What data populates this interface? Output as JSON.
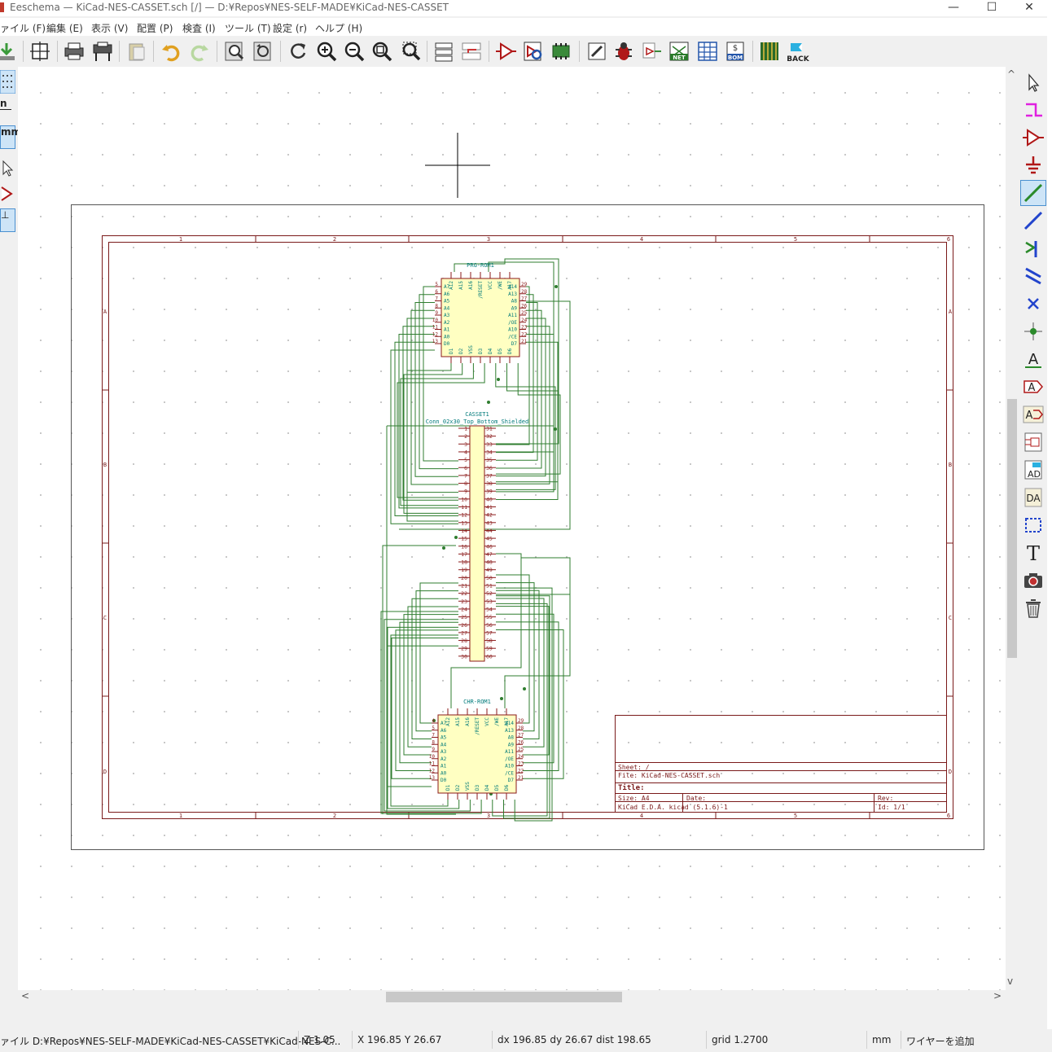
{
  "window": {
    "title": "Eeschema — KiCad-NES-CASSET.sch [/] — D:¥Repos¥NES-SELF-MADE¥KiCad-NES-CASSET",
    "controls": {
      "minimize": "—",
      "maximize": "☐",
      "close": "✕"
    }
  },
  "menu": [
    "ァイル (F)",
    "編集 (E)",
    "表示 (V)",
    "配置 (P)",
    "検査 (I)",
    "ツール (T)",
    "設定 (r)",
    "ヘルプ (H)"
  ],
  "toolbar": {
    "icons": [
      "save-icon",
      "page-settings-icon",
      "print-icon",
      "plot-icon",
      "paste-icon",
      "undo-icon",
      "redo-icon",
      "find-icon",
      "find-replace-icon",
      "redraw-icon",
      "zoom-in-icon",
      "zoom-out-icon",
      "zoom-fit-icon",
      "zoom-selection-icon",
      "hierarchy-navigator-icon",
      "leave-sheet-icon",
      "symbol-editor-icon",
      "symbol-browser-icon",
      "annotate-icon",
      "footprint-assign-icon",
      "erc-icon",
      "netlist-icon",
      "edit-fields-icon",
      "bom-icon",
      "pcbnew-icon",
      "back-annotate-icon"
    ],
    "net_label": "NET",
    "bom_label": "BOM",
    "back_label": "BACK"
  },
  "left_toolbar": {
    "labels": [
      "n",
      "mm",
      "⊥"
    ]
  },
  "schematic": {
    "frame_columns": [
      "1",
      "2",
      "3",
      "4",
      "5",
      "6"
    ],
    "frame_rows": [
      "A",
      "B",
      "C",
      "D"
    ],
    "prg_rom": {
      "ref": "PRG-ROM1",
      "left_pins": [
        {
          "num": "5",
          "name": "A7"
        },
        {
          "num": "6",
          "name": "A6"
        },
        {
          "num": "7",
          "name": "A5"
        },
        {
          "num": "8",
          "name": "A4"
        },
        {
          "num": "9",
          "name": "A3"
        },
        {
          "num": "10",
          "name": "A2"
        },
        {
          "num": "11",
          "name": "A1"
        },
        {
          "num": "12",
          "name": "A0"
        },
        {
          "num": "13",
          "name": "D0"
        }
      ],
      "right_pins": [
        {
          "num": "29",
          "name": "A14"
        },
        {
          "num": "28",
          "name": "A13"
        },
        {
          "num": "27",
          "name": "A8"
        },
        {
          "num": "26",
          "name": "A9"
        },
        {
          "num": "25",
          "name": "A11"
        },
        {
          "num": "24",
          "name": "/OE"
        },
        {
          "num": "23",
          "name": "A10"
        },
        {
          "num": "22",
          "name": "/CE"
        },
        {
          "num": "21",
          "name": "D7"
        }
      ],
      "top_pins": [
        "A12",
        "A15",
        "A16",
        "/RESET",
        "VCC",
        "/WE",
        "A17"
      ],
      "bottom_pins": [
        "D1",
        "D2",
        "VSS",
        "D3",
        "D4",
        "D5",
        "D6"
      ]
    },
    "connector": {
      "ref": "CASSET1",
      "value": "Conn_02x30_Top_Bottom_Shielded",
      "left_pins": [
        "1",
        "2",
        "3",
        "4",
        "5",
        "6",
        "7",
        "8",
        "9",
        "10",
        "11",
        "12",
        "13",
        "14",
        "15",
        "16",
        "17",
        "18",
        "19",
        "20",
        "21",
        "22",
        "23",
        "24",
        "25",
        "26",
        "27",
        "28",
        "29",
        "30"
      ],
      "right_pins": [
        "31",
        "32",
        "33",
        "34",
        "35",
        "36",
        "37",
        "38",
        "39",
        "40",
        "41",
        "42",
        "43",
        "44",
        "45",
        "46",
        "47",
        "48",
        "49",
        "50",
        "51",
        "52",
        "53",
        "54",
        "55",
        "56",
        "57",
        "58",
        "59",
        "60"
      ]
    },
    "chr_rom": {
      "ref": "CHR-ROM1",
      "left_pins": [
        {
          "num": "4",
          "name": "A7"
        },
        {
          "num": "5",
          "name": "A6"
        },
        {
          "num": "7",
          "name": "A5"
        },
        {
          "num": "8",
          "name": "A4"
        },
        {
          "num": "9",
          "name": "A3"
        },
        {
          "num": "10",
          "name": "A2"
        },
        {
          "num": "11",
          "name": "A1"
        },
        {
          "num": "12",
          "name": "A0"
        },
        {
          "num": "13",
          "name": "D0"
        }
      ],
      "right_pins": [
        {
          "num": "29",
          "name": "A14"
        },
        {
          "num": "28",
          "name": "A13"
        },
        {
          "num": "27",
          "name": "A8"
        },
        {
          "num": "26",
          "name": "A9"
        },
        {
          "num": "25",
          "name": "A11"
        },
        {
          "num": "24",
          "name": "/OE"
        },
        {
          "num": "23",
          "name": "A10"
        },
        {
          "num": "22",
          "name": "/CE"
        },
        {
          "num": "21",
          "name": "D7"
        }
      ],
      "top_pins": [
        "A12",
        "A15",
        "A16",
        "/RESET",
        "VCC",
        "/WE",
        "A17"
      ],
      "bottom_pins": [
        "D1",
        "D2",
        "VSS",
        "D3",
        "D4",
        "D5",
        "D6"
      ]
    },
    "title_block": {
      "sheet": "Sheet: /",
      "file": "File: KiCad-NES-CASSET.sch",
      "title": "Title:",
      "size": "Size: A4",
      "date": "Date:",
      "rev": "Rev:",
      "tool": "KiCad E.D.A.  kicad (5.1.6)-1",
      "id": "Id: 1/1"
    }
  },
  "right_toolbar": {
    "icons": [
      "select-icon",
      "highlight-net-icon",
      "add-symbol-icon",
      "add-power-icon",
      "add-wire-icon",
      "add-bus-icon",
      "wire-bus-entry-icon",
      "bus-bus-entry-icon",
      "no-connect-icon",
      "add-junction-icon",
      "net-label-icon",
      "global-label-icon",
      "hier-label-icon",
      "hier-sheet-icon",
      "import-sheet-pin-icon",
      "add-sheet-pin-icon",
      "add-graphic-line-icon",
      "add-text-icon",
      "add-image-icon",
      "delete-icon"
    ],
    "label_a": "A",
    "label_t": "T"
  },
  "status": {
    "file": "ァイル D:¥Repos¥NES-SELF-MADE¥KiCad-NES-CASSET¥KiCad-NES-C...",
    "zoom": "Z 1.05",
    "coords": "X 196.85  Y 26.67",
    "delta": "dx 196.85  dy 26.67  dist 198.65",
    "grid": "grid 1.2700",
    "units": "mm",
    "mode": "ワイヤーを追加"
  },
  "colors": {
    "wire": "#2f7d2f",
    "sheet": "#8b1a1a",
    "body": "#ffffc2",
    "pin_name": "#007a7a",
    "frame": "#7a1a1a"
  }
}
